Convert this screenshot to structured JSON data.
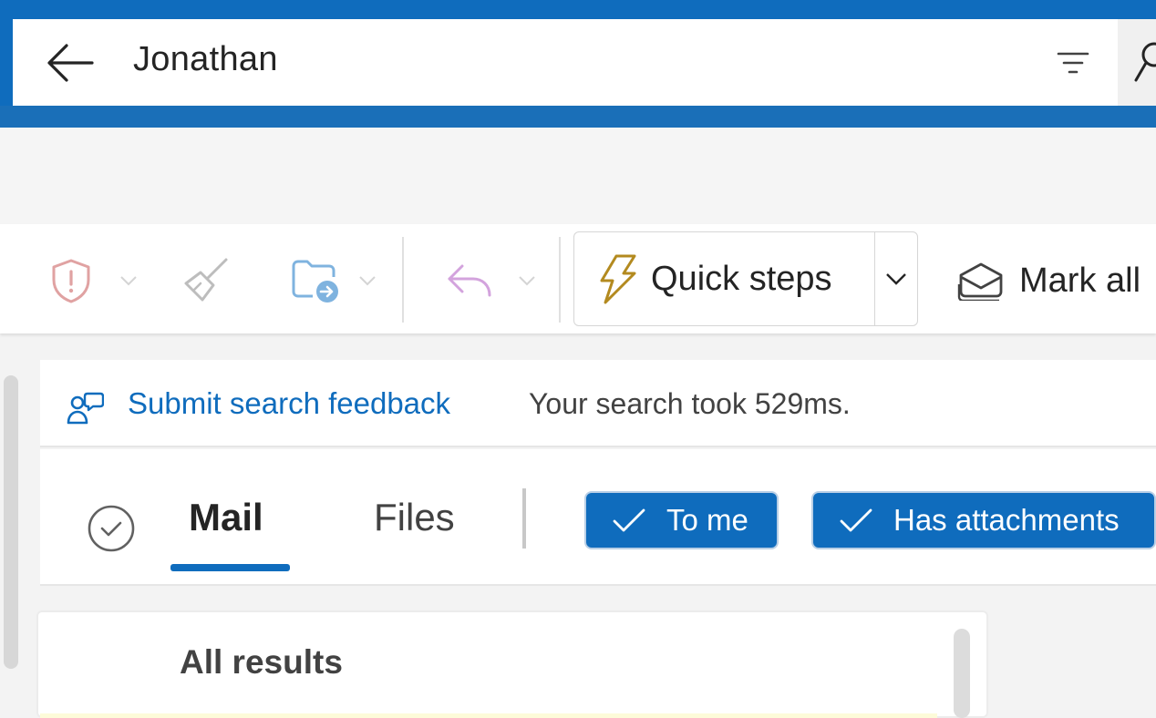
{
  "search": {
    "query": "Jonathan"
  },
  "icons": {
    "back": "back-arrow-icon",
    "filter": "filter-icon",
    "search": "search-icon",
    "report": "shield-icon",
    "sweep": "broom-icon",
    "move": "move-to-folder-icon",
    "reply": "reply-icon",
    "quick_steps": "lightning-icon",
    "mark_all": "envelope-open-icon",
    "feedback": "chat-feedback-icon",
    "select_all": "checkmark-circle-icon"
  },
  "ribbon": {
    "quick_steps_label": "Quick steps",
    "mark_all_label": "Mark all"
  },
  "feedback": {
    "link_label": "Submit search feedback",
    "time_text": "Your search took 529ms."
  },
  "tabs": [
    {
      "label": "Mail",
      "selected": true
    },
    {
      "label": "Files",
      "selected": false
    }
  ],
  "filters": [
    {
      "label": "To me",
      "checked": true
    },
    {
      "label": "Has attachments",
      "checked": true
    }
  ],
  "results": {
    "heading": "All results"
  },
  "colors": {
    "brand": "#0f6cbd",
    "report_disabled": "#e0a2a2",
    "move_disabled": "#7fb3df",
    "reply_disabled": "#d3a3dd",
    "quick_steps_icon": "#b38a1f"
  }
}
